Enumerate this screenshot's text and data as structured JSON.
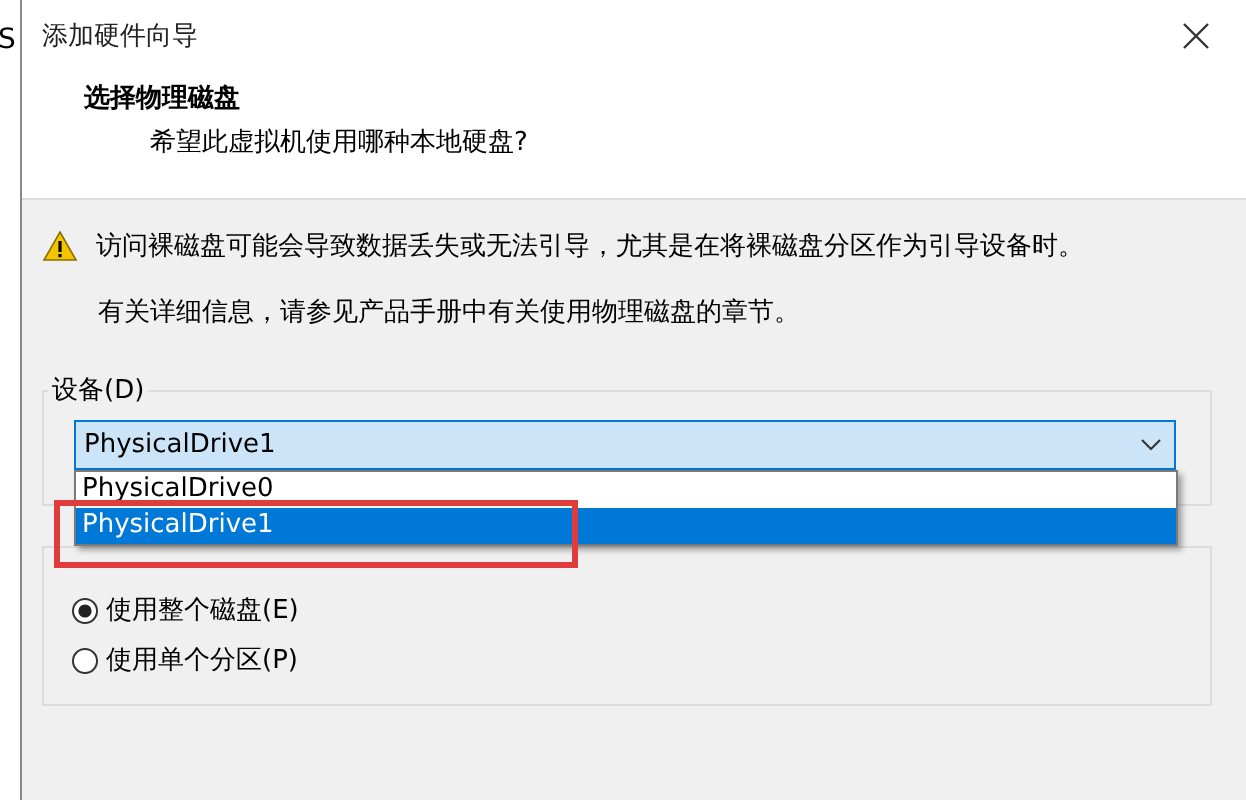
{
  "background_window": {
    "edge_text": "S"
  },
  "window": {
    "title": "添加硬件向导"
  },
  "header": {
    "title": "选择物理磁盘",
    "subtitle": "希望此虚拟机使用哪种本地硬盘?"
  },
  "warning": {
    "text": "访问裸磁盘可能会导致数据丢失或无法引导，尤其是在将裸磁盘分区作为引导设备时。"
  },
  "info": "有关详细信息，请参见产品手册中有关使用物理磁盘的章节。",
  "device_group": {
    "label": "设备(D)",
    "value": "PhysicalDrive1",
    "expanded": true,
    "options": [
      {
        "label": "PhysicalDrive0",
        "selected": false
      },
      {
        "label": "PhysicalDrive1",
        "selected": true
      }
    ]
  },
  "usage_group": {
    "radios": [
      {
        "label": "使用整个磁盘(E)",
        "selected": true
      },
      {
        "label": "使用单个分区(P)",
        "selected": false
      }
    ]
  },
  "highlight": {
    "color": "#e03c3c"
  }
}
